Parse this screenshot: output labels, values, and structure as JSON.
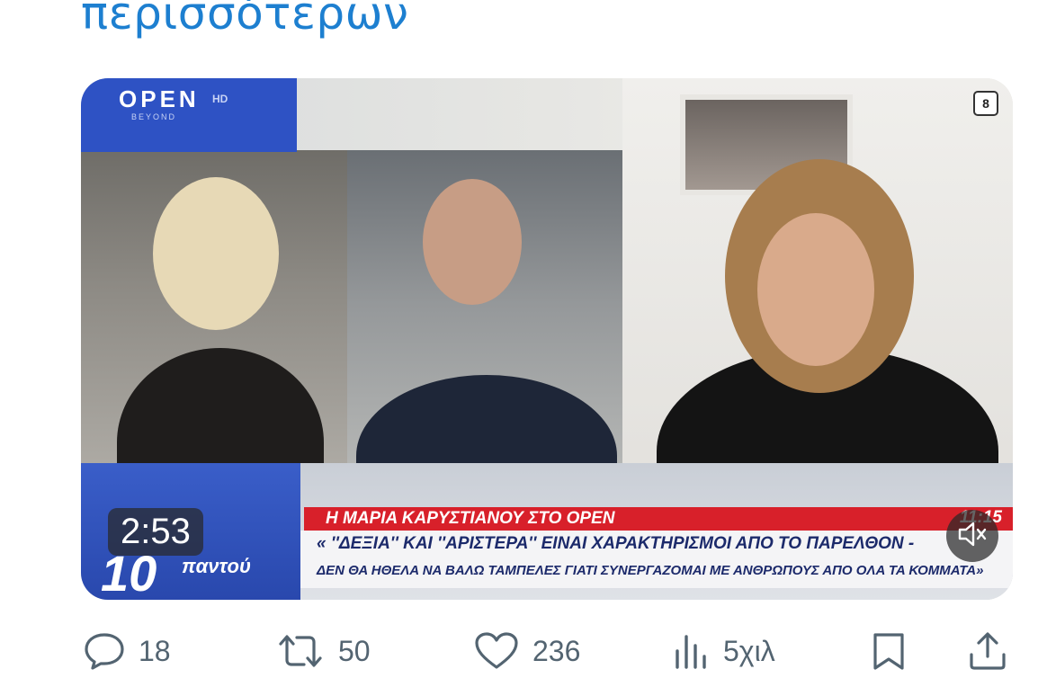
{
  "tweet": {
    "text": "περισσότερων"
  },
  "video": {
    "channel_logo": "OPEN",
    "channel_logo_hd": "HD",
    "channel_logo_sub": "BEYOND",
    "channel_badge": "8",
    "show_logo_number": "10",
    "show_logo_word": "παντού",
    "headline": "Η ΜΑΡΙΑ ΚΑΡΥΣΤΙΑΝΟΥ ΣΤΟ OPEN",
    "time": "11:15",
    "subtitle_line1": "« ''ΔΕΞΙΑ'' ΚΑΙ ''ΑΡΙΣΤΕΡΑ'' ΕΙΝΑΙ ΧΑΡΑΚΤΗΡΙΣΜΟΙ ΑΠΟ ΤΟ ΠΑΡΕΛΘΟΝ -",
    "subtitle_line2": "ΔΕΝ ΘΑ ΗΘΕΛΑ ΝΑ ΒΑΛΩ ΤΑΜΠΕΛΕΣ ΓΙΑΤΙ ΣΥΝΕΡΓΑΖΟΜΑΙ ΜΕ ΑΝΘΡΩΠΟΥΣ ΑΠΟ ΟΛΑ ΤΑ ΚΟΜΜΑΤΑ»",
    "duration": "2:53",
    "mute_icon": "speaker-muted-icon"
  },
  "actions": {
    "replies": "18",
    "retweets": "50",
    "likes": "236",
    "views": "5χιλ",
    "icons": [
      "reply-icon",
      "retweet-icon",
      "like-icon",
      "views-icon",
      "bookmark-icon",
      "share-icon"
    ]
  },
  "colors": {
    "link_blue": "#1d7fd0",
    "icon_gray": "#536471",
    "ticker_red": "#d8202a",
    "channel_blue": "#2e52c4"
  }
}
